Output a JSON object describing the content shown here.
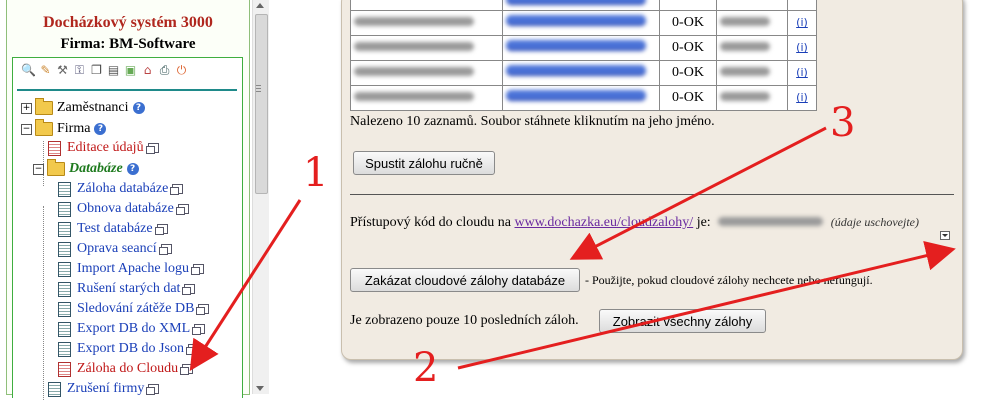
{
  "sidebar": {
    "title": "Docházkový systém 3000",
    "company": "Firma: BM-Software",
    "toolbar_icons": [
      "magnifier-icon",
      "pencil-icon",
      "tools-icon",
      "key-icon",
      "copy-icon",
      "documents-icon",
      "money-icon",
      "house-icon",
      "print-icon",
      "power-icon"
    ],
    "tree": [
      {
        "label": "Zaměstnanci",
        "kind": "folder",
        "expander": "+",
        "help": true
      },
      {
        "label": "Firma",
        "kind": "folder",
        "expander": "−",
        "help": true
      },
      {
        "label": "Editace údajů",
        "kind": "doc-red"
      },
      {
        "label": "Databáze",
        "kind": "folder-green",
        "expander": "−",
        "help": true
      },
      {
        "label": "Záloha databáze",
        "kind": "doc"
      },
      {
        "label": "Obnova databáze",
        "kind": "doc"
      },
      {
        "label": "Test databáze",
        "kind": "doc"
      },
      {
        "label": "Oprava seancí",
        "kind": "doc"
      },
      {
        "label": "Import Apache logu",
        "kind": "doc"
      },
      {
        "label": "Rušení starých dat",
        "kind": "doc"
      },
      {
        "label": "Sledování zátěže DB",
        "kind": "doc"
      },
      {
        "label": "Export DB do XML",
        "kind": "doc"
      },
      {
        "label": "Export DB do Json",
        "kind": "doc"
      },
      {
        "label": "Záloha do Cloudu",
        "kind": "doc-red"
      },
      {
        "label": "Zrušení firmy",
        "kind": "doc"
      }
    ]
  },
  "backups_table": {
    "rows": [
      {
        "status": "0-OK",
        "info": "(i)"
      },
      {
        "status": "0-OK",
        "info": "(i)"
      },
      {
        "status": "0-OK",
        "info": "(i)"
      },
      {
        "status": "0-OK",
        "info": "(i)"
      }
    ]
  },
  "main": {
    "found_text": "Nalezeno 10 zaznamů. Soubor stáhnete kliknutím na jeho jméno.",
    "run_backup_button": "Spustit zálohu ručně",
    "access_code_prefix": "Přístupový kód do cloudu na",
    "cloud_link": "www.dochazka.eu/cloudzalohy/",
    "access_code_suffix": "je:",
    "keep_note": "(údaje uschovejte)",
    "disable_cloud_button": "Zakázat cloudové zálohy databáze",
    "disable_cloud_note": "- Použijte, pokud cloudové zálohy nechcete nebo nefungují.",
    "shown_text": "Je zobrazeno pouze 10 posledních záloh.",
    "show_all_button": "Zobrazit všechny zálohy"
  },
  "annotations": {
    "n1": "1",
    "n2": "2",
    "n3": "3"
  },
  "colors": {
    "title": "#b0271e",
    "arrow": "#e41f1f",
    "panel": "#f1ebe2",
    "link": "#1a3fb8"
  }
}
